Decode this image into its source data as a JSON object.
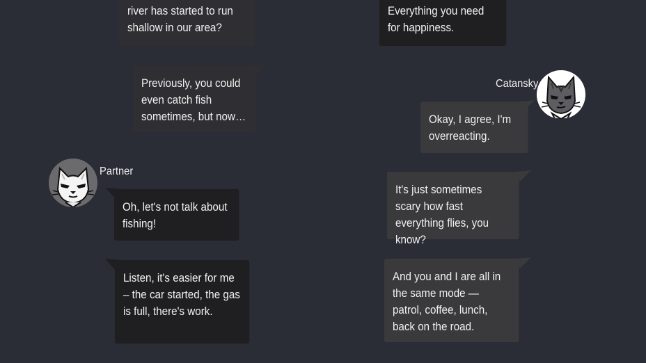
{
  "characters": {
    "partner": {
      "name": "Partner",
      "avatar_icon": "white-cat-avatar-icon"
    },
    "catansky": {
      "name": "Catansky",
      "avatar_icon": "gray-cat-avatar-icon"
    }
  },
  "left_messages": [
    {
      "text": "river has started to run shallow in our area?"
    },
    {
      "text": "Previously, you could even catch fish sometimes, but now…"
    },
    {
      "text": "Oh, let's not talk about fishing!"
    },
    {
      "text": "Listen, it's easier for me – the car started, the gas is full, there's work."
    }
  ],
  "right_messages": [
    {
      "text": "Everything you need for happiness."
    },
    {
      "text": "Okay, I agree, I'm overreacting."
    },
    {
      "text": "It's just sometimes scary how fast everything flies, you know?"
    },
    {
      "text": "And you and I are all in the same mode — patrol, coffee, lunch, back on the road."
    }
  ],
  "colors": {
    "background": "#2a2c36",
    "bubble_dark": "#1f1f22",
    "bubble_mid": "#2f2f33",
    "bubble_gray": "#3a3a3d",
    "text": "#f1f1f1"
  }
}
